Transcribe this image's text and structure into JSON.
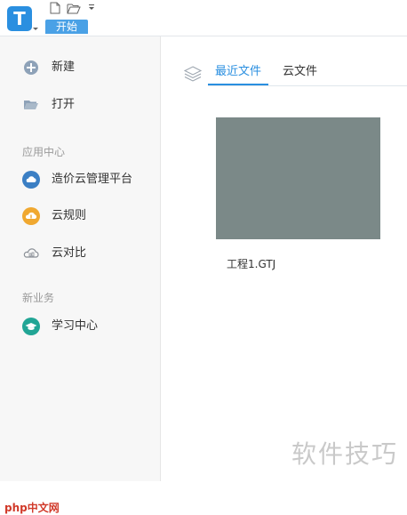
{
  "app": {
    "logo_letter": "T",
    "ribbon_tab": "开始"
  },
  "sidebar": {
    "new_label": "新建",
    "open_label": "打开",
    "section_app_center": "应用中心",
    "cost_cloud_label": "造价云管理平台",
    "cloud_rules_label": "云规则",
    "cloud_compare_label": "云对比",
    "section_new_business": "新业务",
    "learning_center_label": "学习中心"
  },
  "main": {
    "tabs": [
      {
        "label": "最近文件",
        "active": true
      },
      {
        "label": "云文件",
        "active": false
      }
    ],
    "recent_files": [
      {
        "name": "工程1.GTJ"
      }
    ]
  },
  "watermarks": {
    "php_text": "php中文网",
    "site_text": "软件技巧"
  },
  "colors": {
    "accent": "#2a8fe0",
    "thumbnail": "#7b8988",
    "sidebar_bg": "#f7f7f7"
  }
}
